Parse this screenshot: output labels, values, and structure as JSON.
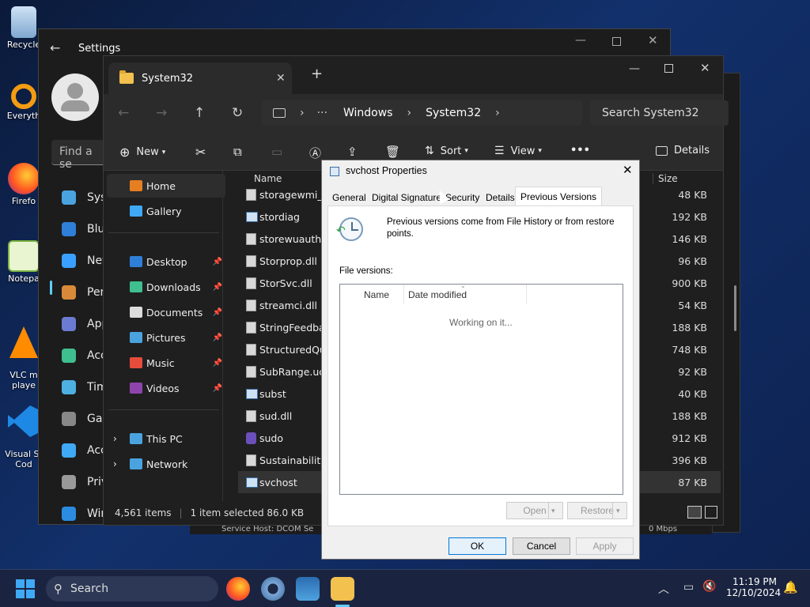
{
  "desktop": {
    "icons": [
      {
        "label": "Recycle",
        "name": "recycle-bin-icon"
      },
      {
        "label": "Everyth",
        "name": "everything-app-icon"
      },
      {
        "label": "Firefo",
        "name": "firefox-icon"
      },
      {
        "label": "Notepa",
        "name": "notepad-icon"
      },
      {
        "label": "VLC m\nplaye",
        "name": "vlc-icon"
      },
      {
        "label": "Visual St\nCod",
        "name": "vscode-icon"
      }
    ]
  },
  "settings": {
    "title": "Settings",
    "search_placeholder": "Find a se",
    "items": [
      "Syst",
      "Blue",
      "Net",
      "Pers",
      "App",
      "Acc",
      "Tim",
      "Gar",
      "Acc",
      "Priv",
      "Win"
    ]
  },
  "explorer": {
    "tab_title": "System32",
    "new_tab": "+",
    "breadcrumb": [
      "Windows",
      "System32"
    ],
    "search_placeholder": "Search System32",
    "toolbar": {
      "new": "New",
      "sort": "Sort",
      "view": "View",
      "more": "•••",
      "details": "Details"
    },
    "nav": [
      {
        "label": "Home",
        "name": "nav-home"
      },
      {
        "label": "Gallery",
        "name": "nav-gallery"
      },
      {
        "label": "Desktop",
        "name": "nav-desktop"
      },
      {
        "label": "Downloads",
        "name": "nav-downloads"
      },
      {
        "label": "Documents",
        "name": "nav-documents"
      },
      {
        "label": "Pictures",
        "name": "nav-pictures"
      },
      {
        "label": "Music",
        "name": "nav-music"
      },
      {
        "label": "Videos",
        "name": "nav-videos"
      },
      {
        "label": "This PC",
        "name": "nav-this-pc"
      },
      {
        "label": "Network",
        "name": "nav-network"
      }
    ],
    "columns": {
      "name": "Name",
      "size": "Size"
    },
    "files": [
      {
        "name": "storagewmi_pa",
        "size": "48 KB"
      },
      {
        "name": "stordiag",
        "size": "192 KB"
      },
      {
        "name": "storewuauth.dl",
        "size": "146 KB"
      },
      {
        "name": "Storprop.dll",
        "size": "96 KB"
      },
      {
        "name": "StorSvc.dll",
        "size": "900 KB"
      },
      {
        "name": "streamci.dll",
        "size": "54 KB"
      },
      {
        "name": "StringFeedback",
        "size": "188 KB"
      },
      {
        "name": "StructuredQue",
        "size": "748 KB"
      },
      {
        "name": "SubRange.uce",
        "size": "92 KB"
      },
      {
        "name": "subst",
        "size": "40 KB"
      },
      {
        "name": "sud.dll",
        "size": "188 KB"
      },
      {
        "name": "sudo",
        "size": "912 KB"
      },
      {
        "name": "SustainabilitySe",
        "size": "396 KB"
      },
      {
        "name": "svchost",
        "size": "87 KB"
      }
    ],
    "status": {
      "items": "4,561 items",
      "selected": "1 item selected  86.0 KB"
    },
    "behind_text": "Service Host: DCOM Se",
    "behind_speed": "0 Mbps"
  },
  "dialog": {
    "title": "svchost Properties",
    "tabs": [
      "General",
      "Digital Signatures",
      "Security",
      "Details",
      "Previous Versions"
    ],
    "description": "Previous versions come from File History or from restore points.",
    "file_versions_label": "File versions:",
    "columns": {
      "name": "Name",
      "date": "Date modified"
    },
    "loading": "Working on it...",
    "open_button": "Open",
    "restore_button": "Restore",
    "ok": "OK",
    "cancel": "Cancel",
    "apply": "Apply"
  },
  "taskbar": {
    "search": "Search",
    "time": "11:19 PM",
    "date": "12/10/2024"
  }
}
